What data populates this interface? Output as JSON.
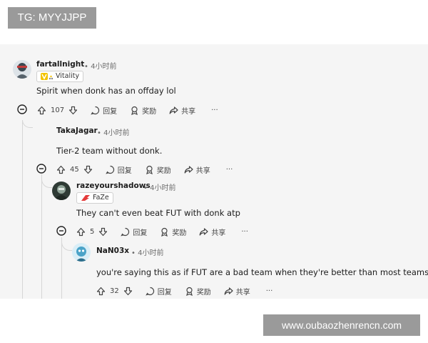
{
  "watermarks": {
    "top": "TG: MYYJJPP",
    "bottom": "www.oubaozhenrencn.com"
  },
  "labels": {
    "reply": "回复",
    "award": "奖励",
    "share": "共享",
    "more": "···"
  },
  "comments": [
    {
      "username": "fartallnight",
      "time": "• 4小时前",
      "flair": "Vitality",
      "text": "Spirit when donk has an offday lol",
      "votes": "107"
    },
    {
      "username": "TakaJagar",
      "time": "• 4小时前",
      "flair": "",
      "text": "Tier-2 team without donk.",
      "votes": "45"
    },
    {
      "username": "razeyourshadows",
      "time": "• 4小时前",
      "flair": "FaZe",
      "text": "They can't even beat FUT with donk atp",
      "votes": "5"
    },
    {
      "username": "NaN03x",
      "time": "• 4小时前",
      "flair": "",
      "text": "you're saying this as if FUT are a bad team when they're better than most teams atp",
      "votes": "32"
    }
  ],
  "colors": {
    "panel": "#f5f5f5",
    "watermark_bg": "#9a9a9a",
    "vitality": "#f3c300",
    "faze": "#e43b3b"
  }
}
